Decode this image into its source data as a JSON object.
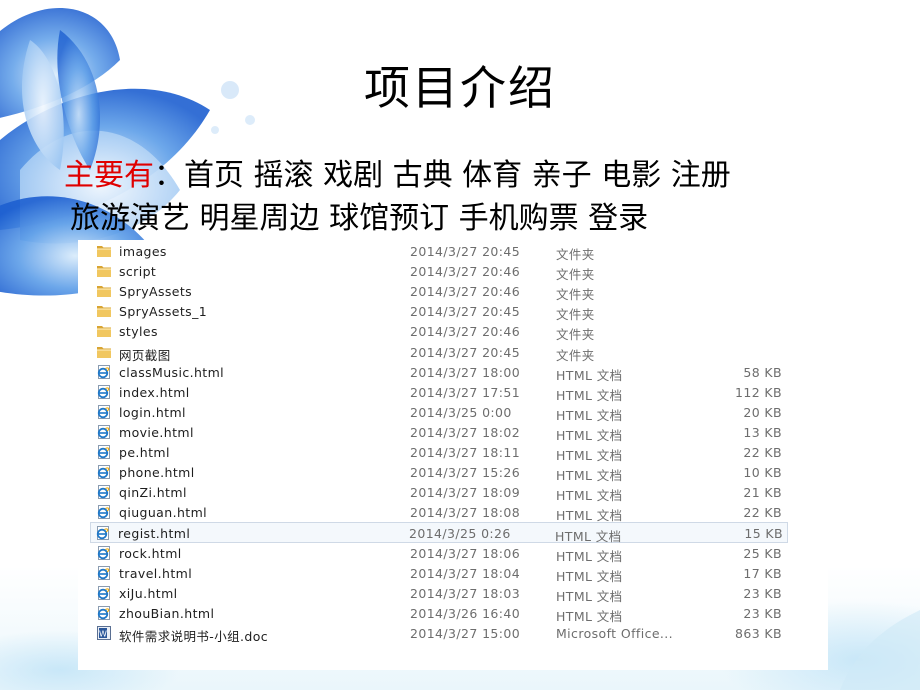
{
  "slide": {
    "title": "项目介绍",
    "intro_label": "主要有",
    "intro_colon": "：",
    "line1_items": "首页 摇滚 戏剧 古典 体育 亲子 电影  注册",
    "line2_items": "旅游演艺 明星周边 球馆预订 手机购票 登录"
  },
  "colors": {
    "highlight": "#e00000",
    "background_flower": "#2a6ed8",
    "folder": "#e8b84a",
    "html_icon": "#1f78c8"
  },
  "explorer": {
    "rows": [
      {
        "name": "images",
        "date": "2014/3/27 20:45",
        "type": "文件夹",
        "size": "",
        "icon": "folder-icon"
      },
      {
        "name": "script",
        "date": "2014/3/27 20:46",
        "type": "文件夹",
        "size": "",
        "icon": "folder-icon"
      },
      {
        "name": "SpryAssets",
        "date": "2014/3/27 20:46",
        "type": "文件夹",
        "size": "",
        "icon": "folder-icon"
      },
      {
        "name": "SpryAssets_1",
        "date": "2014/3/27 20:45",
        "type": "文件夹",
        "size": "",
        "icon": "folder-icon"
      },
      {
        "name": "styles",
        "date": "2014/3/27 20:46",
        "type": "文件夹",
        "size": "",
        "icon": "folder-icon"
      },
      {
        "name": "网页截图",
        "date": "2014/3/27 20:45",
        "type": "文件夹",
        "size": "",
        "icon": "folder-icon"
      },
      {
        "name": "classMusic.html",
        "date": "2014/3/27 18:00",
        "type": "HTML 文档",
        "size": "58 KB",
        "icon": "html-file-icon"
      },
      {
        "name": "index.html",
        "date": "2014/3/27 17:51",
        "type": "HTML 文档",
        "size": "112 KB",
        "icon": "html-file-icon"
      },
      {
        "name": "login.html",
        "date": "2014/3/25 0:00",
        "type": "HTML 文档",
        "size": "20 KB",
        "icon": "html-file-icon"
      },
      {
        "name": "movie.html",
        "date": "2014/3/27 18:02",
        "type": "HTML 文档",
        "size": "13 KB",
        "icon": "html-file-icon"
      },
      {
        "name": "pe.html",
        "date": "2014/3/27 18:11",
        "type": "HTML 文档",
        "size": "22 KB",
        "icon": "html-file-icon"
      },
      {
        "name": "phone.html",
        "date": "2014/3/27 15:26",
        "type": "HTML 文档",
        "size": "10 KB",
        "icon": "html-file-icon"
      },
      {
        "name": "qinZi.html",
        "date": "2014/3/27 18:09",
        "type": "HTML 文档",
        "size": "21 KB",
        "icon": "html-file-icon"
      },
      {
        "name": "qiuguan.html",
        "date": "2014/3/27 18:08",
        "type": "HTML 文档",
        "size": "22 KB",
        "icon": "html-file-icon"
      },
      {
        "name": "regist.html",
        "date": "2014/3/25 0:26",
        "type": "HTML 文档",
        "size": "15 KB",
        "icon": "html-file-icon",
        "selected": true
      },
      {
        "name": "rock.html",
        "date": "2014/3/27 18:06",
        "type": "HTML 文档",
        "size": "25 KB",
        "icon": "html-file-icon"
      },
      {
        "name": "travel.html",
        "date": "2014/3/27 18:04",
        "type": "HTML 文档",
        "size": "17 KB",
        "icon": "html-file-icon"
      },
      {
        "name": "xiJu.html",
        "date": "2014/3/27 18:03",
        "type": "HTML 文档",
        "size": "23 KB",
        "icon": "html-file-icon"
      },
      {
        "name": "zhouBian.html",
        "date": "2014/3/26 16:40",
        "type": "HTML 文档",
        "size": "23 KB",
        "icon": "html-file-icon"
      },
      {
        "name": "软件需求说明书-小组.doc",
        "date": "2014/3/27 15:00",
        "type": "Microsoft Office...",
        "size": "863 KB",
        "icon": "word-doc-icon"
      }
    ]
  }
}
